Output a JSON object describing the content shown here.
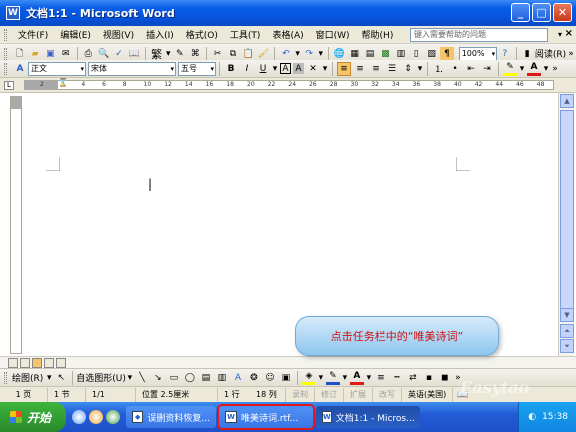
{
  "window": {
    "title": "文档1:1 - Microsoft Word",
    "app_icon": "W"
  },
  "menu": {
    "items": [
      "文件(F)",
      "编辑(E)",
      "视图(V)",
      "插入(I)",
      "格式(O)",
      "工具(T)",
      "表格(A)",
      "窗口(W)",
      "帮助(H)"
    ],
    "help_placeholder": "键入需要帮助的问题"
  },
  "toolbar": {
    "zoom": "100%",
    "read_label": "阅读(R)",
    "style": "正文",
    "font": "宋体",
    "size": "五号",
    "bold": "B",
    "italic": "I",
    "underline": "U",
    "char_border": "A",
    "char_shade": "A",
    "font_color": "A"
  },
  "ruler": {
    "ticks": [
      "2",
      "2",
      "4",
      "6",
      "8",
      "10",
      "12",
      "14",
      "16",
      "18",
      "20",
      "22",
      "24",
      "26",
      "28",
      "30",
      "32",
      "34",
      "36",
      "38",
      "40",
      "42",
      "44",
      "46",
      "48"
    ]
  },
  "drawing": {
    "draw_label": "绘图(R)",
    "autoshape_label": "自选图形(U)"
  },
  "status": {
    "page": "1 页",
    "section": "1 节",
    "page_of": "1/1",
    "position": "位置 2.5厘米",
    "line": "1 行",
    "column": "18 列",
    "rec": "录制",
    "trk": "修订",
    "ext": "扩展",
    "ovr": "改写",
    "language": "英语(美国)"
  },
  "callout": {
    "text": "点击任务栏中的“唯美诗词”"
  },
  "taskbar": {
    "start_label": "开始",
    "tasks": [
      "误删资料恢复...",
      "唯美诗词.rtf...",
      "文档1:1 - Micros..."
    ],
    "clock": "15:38"
  },
  "watermark": "Easytao"
}
